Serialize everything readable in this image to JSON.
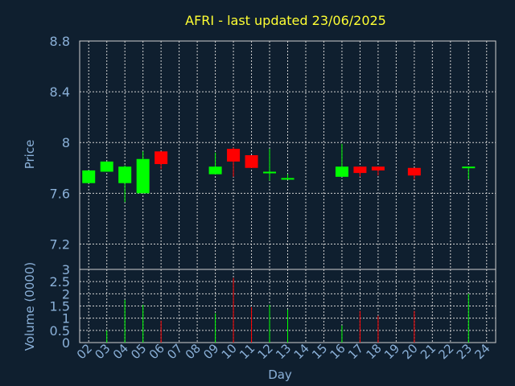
{
  "colors": {
    "background": "#0f1f2f",
    "up": "#00ff00",
    "down": "#ff0000",
    "grid": "#d0d0d0",
    "axis_text": "#8ab0d8",
    "title": "#ffff33"
  },
  "chart_data": [
    {
      "type": "candlestick",
      "title": "AFRI - last updated 23/06/2025",
      "ylabel": "Price",
      "ylim": [
        7.0,
        8.8
      ],
      "yticks": [
        "7.2",
        "7.6",
        "8",
        "8.4",
        "8.8"
      ],
      "grid": true,
      "candles": [
        {
          "day": "02",
          "open": 7.68,
          "close": 7.78,
          "high": 7.78,
          "low": 7.68
        },
        {
          "day": "03",
          "open": 7.77,
          "close": 7.85,
          "high": 7.85,
          "low": 7.77
        },
        {
          "day": "04",
          "open": 7.68,
          "close": 7.81,
          "high": 7.82,
          "low": 7.53
        },
        {
          "day": "05",
          "open": 7.6,
          "close": 7.87,
          "high": 7.93,
          "low": 7.6
        },
        {
          "day": "06",
          "open": 7.93,
          "close": 7.83,
          "high": 7.93,
          "low": 7.79
        },
        {
          "day": "09",
          "open": 7.75,
          "close": 7.81,
          "high": 7.92,
          "low": 7.75
        },
        {
          "day": "10",
          "open": 7.95,
          "close": 7.85,
          "high": 7.96,
          "low": 7.73
        },
        {
          "day": "11",
          "open": 7.9,
          "close": 7.8,
          "high": 7.9,
          "low": 7.8
        },
        {
          "day": "12",
          "open": 7.77,
          "close": 7.77,
          "high": 7.95,
          "low": 7.7
        },
        {
          "day": "13",
          "open": 7.72,
          "close": 7.72,
          "high": 7.75,
          "low": 7.72
        },
        {
          "day": "16",
          "open": 7.73,
          "close": 7.81,
          "high": 7.99,
          "low": 7.73
        },
        {
          "day": "17",
          "open": 7.81,
          "close": 7.76,
          "high": 7.81,
          "low": 7.73
        },
        {
          "day": "18",
          "open": 7.81,
          "close": 7.78,
          "high": 7.81,
          "low": 7.74
        },
        {
          "day": "20",
          "open": 7.8,
          "close": 7.74,
          "high": 7.8,
          "low": 7.71
        },
        {
          "day": "23",
          "open": 7.8,
          "close": 7.81,
          "high": 7.81,
          "low": 7.71
        }
      ]
    },
    {
      "type": "bar",
      "xlabel": "Day",
      "ylabel": "Volume (0000)",
      "ylim": [
        0,
        3
      ],
      "yticks": [
        "0",
        "0.5",
        "1",
        "1.5",
        "2",
        "2.5",
        "3"
      ],
      "categories": [
        "02",
        "03",
        "04",
        "05",
        "06",
        "07",
        "08",
        "09",
        "10",
        "11",
        "12",
        "13",
        "14",
        "15",
        "16",
        "17",
        "18",
        "19",
        "20",
        "21",
        "22",
        "23",
        "24"
      ],
      "values": [
        0,
        0.5,
        1.75,
        1.55,
        0.9,
        0,
        0,
        1.2,
        2.65,
        1.45,
        1.55,
        1.35,
        0,
        0,
        0.7,
        1.3,
        1.1,
        0,
        1.3,
        0,
        0,
        2.0,
        0
      ],
      "directions": [
        "",
        "up",
        "up",
        "up",
        "down",
        "",
        "",
        "up",
        "down",
        "down",
        "up",
        "up",
        "",
        "",
        "up",
        "down",
        "down",
        "",
        "down",
        "",
        "",
        "up",
        ""
      ]
    }
  ]
}
